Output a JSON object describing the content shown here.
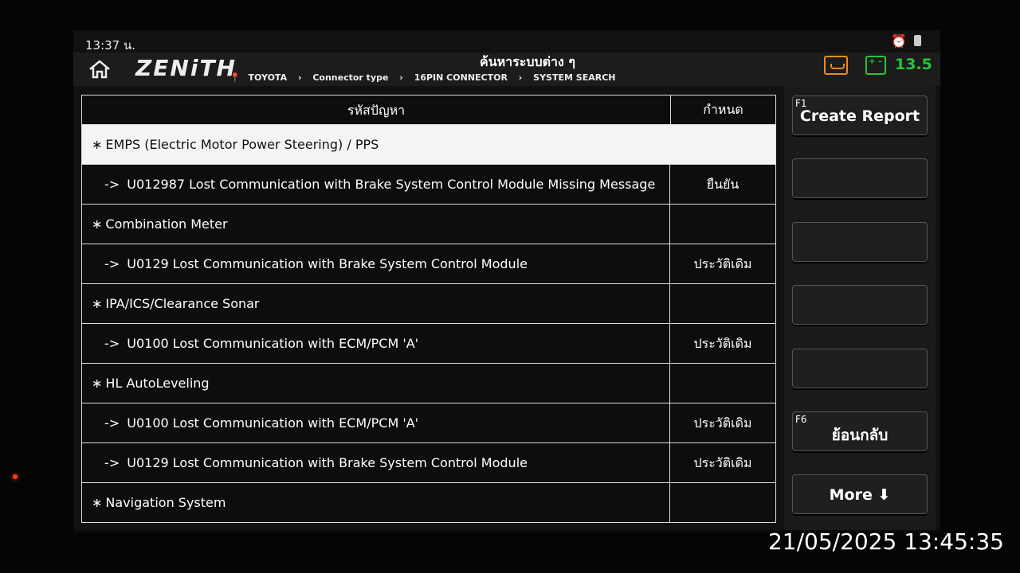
{
  "status_bar": {
    "time": "13:37 น."
  },
  "header": {
    "logo": "ZENiTH",
    "title": "ค้นหาระบบต่าง ๆ",
    "breadcrumb": [
      "TOYOTA",
      "Connector type",
      "16PIN CONNECTOR",
      "SYSTEM SEARCH"
    ],
    "voltage": "13.5"
  },
  "table": {
    "col_code": "รหัสปัญหา",
    "col_status": "กำหนด",
    "rows": [
      {
        "marker": "∗",
        "text": "EMPS (Electric Motor Power Steering) / PPS",
        "status": ""
      },
      {
        "marker": "->",
        "text": "U012987 Lost Communication with Brake System Control Module Missing Message",
        "status": "ยืนยัน"
      },
      {
        "marker": "∗",
        "text": "Combination Meter",
        "status": ""
      },
      {
        "marker": "->",
        "text": "U0129 Lost Communication with Brake System Control Module",
        "status": "ประวัติเดิม"
      },
      {
        "marker": "∗",
        "text": "IPA/ICS/Clearance Sonar",
        "status": ""
      },
      {
        "marker": "->",
        "text": "U0100 Lost Communication with ECM/PCM 'A'",
        "status": "ประวัติเดิม"
      },
      {
        "marker": "∗",
        "text": "HL AutoLeveling",
        "status": ""
      },
      {
        "marker": "->",
        "text": "U0100 Lost Communication with ECM/PCM 'A'",
        "status": "ประวัติเดิม"
      },
      {
        "marker": "->",
        "text": "U0129 Lost Communication with Brake System Control Module",
        "status": "ประวัติเดิม"
      },
      {
        "marker": "∗",
        "text": "Navigation System",
        "status": ""
      }
    ]
  },
  "sidebar": {
    "f1_key": "F1",
    "f1_label": "Create Report",
    "f6_key": "F6",
    "f6_label": "ย้อนกลับ",
    "more_label": "More ⬇"
  },
  "overlay": {
    "timestamp": "21/05/2025 13:45:35"
  },
  "colors": {
    "voltage": "#28c43a",
    "record": "#f08a1c",
    "selected_row": "#f4f4f4"
  }
}
